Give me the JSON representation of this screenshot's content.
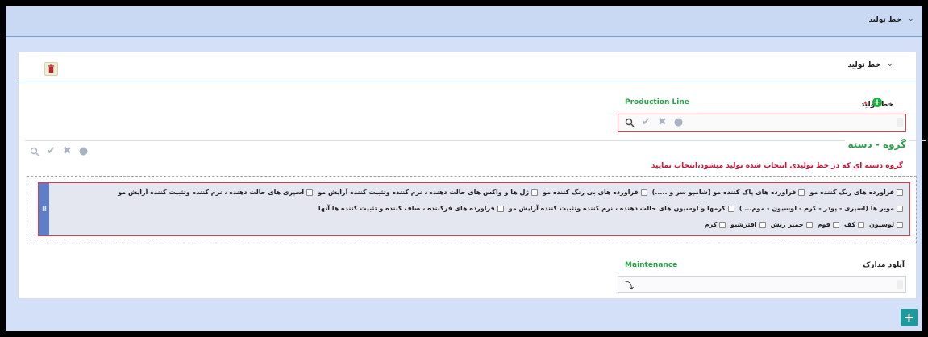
{
  "topbar": {
    "title": "خط تولید",
    "chevron": "chevron-down-icon"
  },
  "panel": {
    "title": "خط تولید",
    "trash_icon": "trash-icon"
  },
  "production_line": {
    "label": "خط تولید",
    "required_mark": "*",
    "field_label": "Production Line",
    "icons": [
      "search-icon",
      "check-icon",
      "close-icon",
      "chat-icon"
    ]
  },
  "group": {
    "title": "گروه - دسته",
    "notice": "گروه دسته ای که در خط تولیدی انتخاب شده تولید میشود،انتخاب نمایید",
    "icons": [
      "search-icon",
      "check-icon",
      "close-icon",
      "chat-icon"
    ],
    "handle": "III",
    "row1": [
      "اسپری های حالت دهنده ، نرم کننده وتثبیت کننده آرایش مو",
      "ژل ها و واکس های حالت دهنده ، نرم کننده وتثبیت کننده آرایش مو",
      "فراورده های بی رنگ کننده مو",
      "فراورده های پاک کننده مو (شامپو سر و .....)",
      "فراورده های رنگ کننده مو"
    ],
    "row2": [
      "فراورده های فرکننده ، صاف کننده و تثبیت کننده ها آنها",
      "کرمها و لوسیون های حالت دهنده ، نرم کننده وتثبیت کننده آرایش مو",
      "موبر ها (اسپری - پودر - کرم - لوسیون - موم... )"
    ],
    "row3": [
      "کرم",
      "افترشیو",
      "خمیر ریش",
      "فوم",
      "کف",
      "لوسیون"
    ]
  },
  "upload": {
    "label": "آپلود مدارک",
    "field_label": "Maintenance"
  },
  "fab": {
    "label": "+"
  },
  "colors": {
    "accent_green": "#29a34a",
    "error_red": "#e13a44",
    "fab_teal": "#1c9a9e",
    "header_blue": "#c9d8f3"
  }
}
